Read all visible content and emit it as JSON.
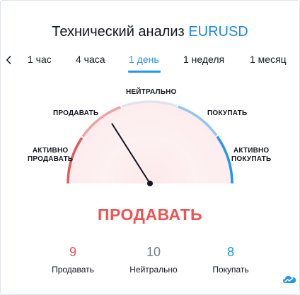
{
  "title": {
    "prefix": "Технический анализ",
    "symbol": "EURUSD"
  },
  "tabs": [
    {
      "label": "1 час",
      "active": false
    },
    {
      "label": "4 часа",
      "active": false
    },
    {
      "label": "1 день",
      "active": true
    },
    {
      "label": "1 неделя",
      "active": false
    },
    {
      "label": "1 месяц",
      "active": false
    }
  ],
  "gauge": {
    "labels": {
      "strong_sell_line1": "АКТИВНО",
      "strong_sell_line2": "ПРОДАВАТЬ",
      "sell": "ПРОДАВАТЬ",
      "neutral": "НЕЙТРАЛЬНО",
      "buy": "ПОКУПАТЬ",
      "strong_buy_line1": "АКТИВНО",
      "strong_buy_line2": "ПОКУПАТЬ"
    },
    "needle_value": -0.36,
    "colors": {
      "strong_sell": "#e05b5b",
      "sell": "#f0a1a1",
      "neutral": "#e0e3eb",
      "buy": "#90c6f3",
      "strong_buy": "#2196f3",
      "needle": "#131722"
    }
  },
  "verdict": "ПРОДАВАТЬ",
  "counts": {
    "sell": {
      "value": "9",
      "label": "Продавать",
      "color": "#ef5350"
    },
    "neutral": {
      "value": "10",
      "label": "Нейтрально",
      "color": "#787b86"
    },
    "buy": {
      "value": "8",
      "label": "Покупать",
      "color": "#2196f3"
    }
  },
  "logo_icon": "tradingview-cloud-icon"
}
